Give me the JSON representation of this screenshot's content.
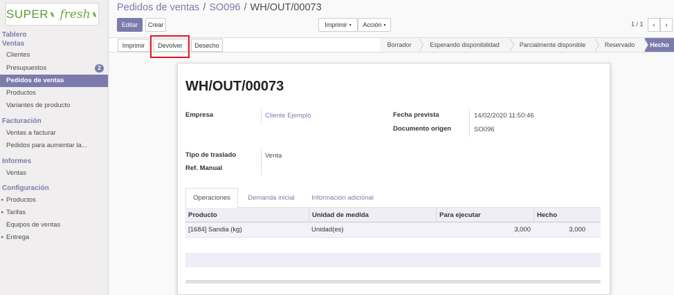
{
  "logo": {
    "text_left": "SUPER",
    "text_right": "fresh"
  },
  "sidebar": {
    "sections": [
      {
        "label": "Tablero"
      },
      {
        "label": "Ventas"
      },
      {
        "label": "Facturación"
      },
      {
        "label": "Informes"
      },
      {
        "label": "Configuración"
      }
    ],
    "items": [
      {
        "label": "Clientes"
      },
      {
        "label": "Presupuestos",
        "badge": "2"
      },
      {
        "label": "Pedidos de ventas"
      },
      {
        "label": "Productos"
      },
      {
        "label": "Variantes de producto"
      },
      {
        "label": "Ventas a facturar"
      },
      {
        "label": "Pedidos para aumentar la..."
      },
      {
        "label": "Ventas"
      },
      {
        "label": "Productos"
      },
      {
        "label": "Tarifas"
      },
      {
        "label": "Equipos de ventas"
      },
      {
        "label": "Entrega"
      }
    ]
  },
  "breadcrumb": {
    "items": [
      "Pedidos de ventas",
      "SO096"
    ],
    "separator": "/",
    "current": "WH/OUT/00073"
  },
  "buttons": {
    "edit": "Editar",
    "create": "Crear",
    "print": "Imprimir",
    "action": "Acción",
    "caret": "▾"
  },
  "pager": {
    "value": "1 / 1",
    "prev": "‹",
    "next": "›"
  },
  "header_actions": {
    "print": "Imprimir",
    "return": "Devolver",
    "scrap": "Desecho"
  },
  "statusbar": {
    "states": [
      "Borrador",
      "Esperando disponibilidad",
      "Parcialmente disponible",
      "Reservado",
      "Hecho"
    ],
    "current": "Hecho"
  },
  "record": {
    "title": "WH/OUT/00073",
    "fields": {
      "partner_label": "Empresa",
      "partner_value": "Cliente Ejemplo",
      "scheduled_label": "Fecha prevista",
      "scheduled_value": "14/02/2020 11:50:46",
      "origin_label": "Documento origen",
      "origin_value": "SO096",
      "picking_type_label": "Tipo de traslado",
      "picking_type_value": "Venta",
      "manual_ref_label": "Ref. Manual"
    }
  },
  "tabs": [
    {
      "label": "Operaciones",
      "active": true
    },
    {
      "label": "Demanda inicial",
      "active": false
    },
    {
      "label": "Información adicional",
      "active": false
    }
  ],
  "table": {
    "headers": [
      "Producto",
      "Unidad de medida",
      "Para ejecutar",
      "Hecho"
    ],
    "rows": [
      {
        "product": "[1684] Sandia (kg)",
        "uom": "Unidad(es)",
        "to_do": "3,000",
        "done": "3,000"
      }
    ]
  },
  "colors": {
    "brand": "#7c7bad",
    "highlight": "#e0141e",
    "logo_green": "#6aa845"
  }
}
